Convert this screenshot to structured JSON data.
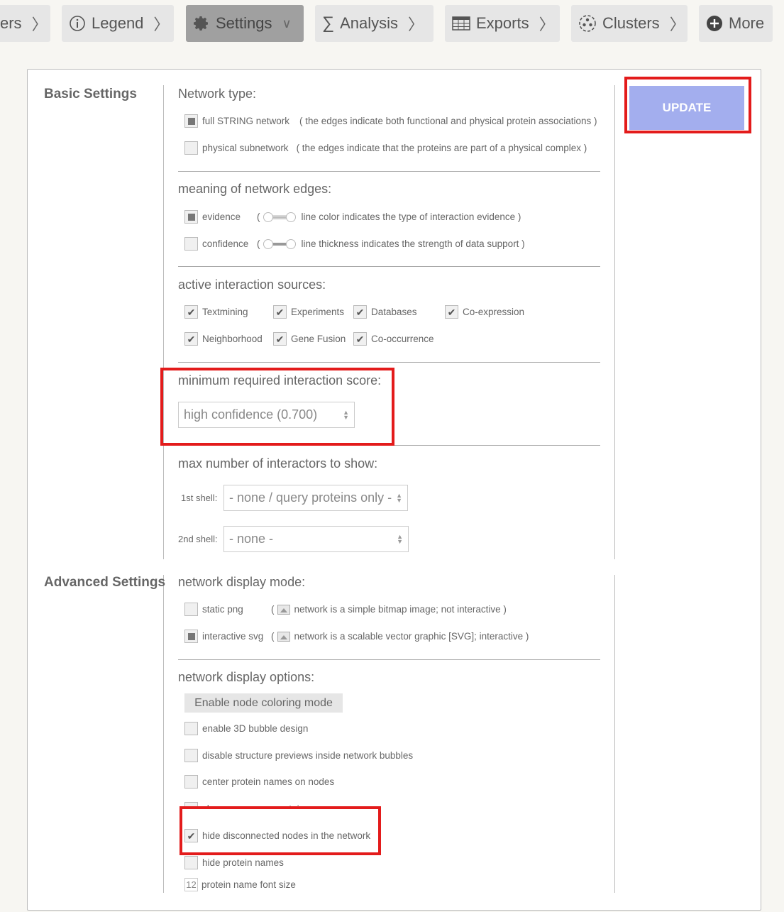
{
  "toolbar": {
    "tabs": [
      {
        "label": "ers",
        "icon": "none"
      },
      {
        "label": "Legend",
        "icon": "info-icon"
      },
      {
        "label": "Settings",
        "icon": "gear-icon",
        "active": true
      },
      {
        "label": "Analysis",
        "icon": "sigma-icon"
      },
      {
        "label": "Exports",
        "icon": "table-icon"
      },
      {
        "label": "Clusters",
        "icon": "clusters-icon"
      },
      {
        "label": "More",
        "icon": "plus-circle-icon"
      }
    ]
  },
  "update_button": "UPDATE",
  "basic": {
    "title": "Basic Settings",
    "network_type": {
      "heading": "Network type:",
      "options": [
        {
          "label": "full STRING network",
          "desc": "( the edges indicate both functional and physical protein associations )",
          "selected": true
        },
        {
          "label": "physical subnetwork",
          "desc": "( the edges indicate that the proteins are part of a physical complex )",
          "selected": false
        }
      ]
    },
    "edges": {
      "heading": "meaning of network edges:",
      "options": [
        {
          "label": "evidence",
          "desc": "line color indicates the type of interaction evidence )",
          "selected": true
        },
        {
          "label": "confidence",
          "desc": "line thickness indicates the strength of data support )",
          "selected": false
        }
      ],
      "paren": "("
    },
    "sources": {
      "heading": "active interaction sources:",
      "items": [
        "Textmining",
        "Experiments",
        "Databases",
        "Co-expression",
        "Neighborhood",
        "Gene Fusion",
        "Co-occurrence"
      ],
      "checked": [
        true,
        true,
        true,
        true,
        true,
        true,
        true
      ]
    },
    "score": {
      "heading": "minimum required interaction score:",
      "value": "high confidence (0.700)"
    },
    "interactors": {
      "heading": "max number of interactors to show:",
      "shell1_label": "1st shell:",
      "shell1_value": "- none / query proteins only -",
      "shell2_label": "2nd shell:",
      "shell2_value": "- none -"
    }
  },
  "advanced": {
    "title": "Advanced Settings",
    "display_mode": {
      "heading": "network display mode:",
      "options": [
        {
          "label": "static png",
          "desc": "network is a simple bitmap image; not interactive )",
          "selected": false
        },
        {
          "label": "interactive svg",
          "desc": "network is a scalable vector graphic [SVG]; interactive )",
          "selected": true
        }
      ],
      "paren": "("
    },
    "display_options": {
      "heading": "network display options:",
      "coloring_button": "Enable node coloring mode",
      "options": [
        {
          "label": "enable 3D bubble design",
          "checked": false
        },
        {
          "label": "disable structure previews inside network bubbles",
          "checked": false
        },
        {
          "label": "center protein names on nodes",
          "checked": false
        },
        {
          "label": "show your query protein names",
          "checked": false
        },
        {
          "label": "hide disconnected nodes in the network",
          "checked": true
        },
        {
          "label": "hide protein names",
          "checked": false
        }
      ],
      "font_size_value": "12",
      "font_size_label": "protein name font size"
    }
  },
  "colors": {
    "update_button": "#a3aeee",
    "highlight": "#e31b1b",
    "active_tab": "#a0a0a0"
  }
}
